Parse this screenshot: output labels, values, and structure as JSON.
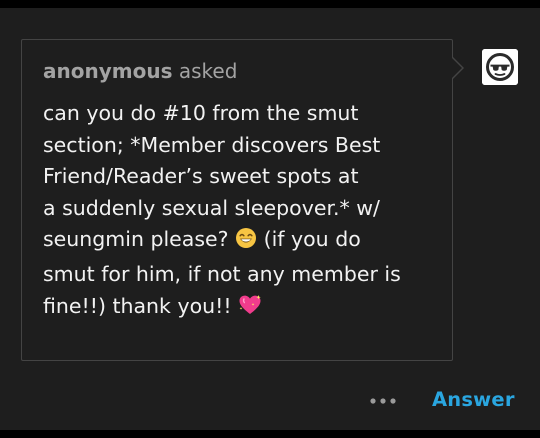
{
  "ask": {
    "asker": "anonymous",
    "asked_label": "asked",
    "question_lines": [
      "can you do #10 from the smut",
      "section; *Member discovers Best",
      "Friend/Reader’s sweet spots at",
      "a suddenly sexual sleepover.* w/",
      "seungmin please? ",
      "(if you do",
      "smut for him, if not any member is",
      "fine!!) thank you!! "
    ],
    "emoji_grin": "grinning-face-with-smiling-eyes",
    "emoji_heart": "sparkling-heart"
  },
  "footer": {
    "more_icon": "ellipsis-icon",
    "answer_label": "Answer"
  },
  "colors": {
    "background": "#1e1e1e",
    "bubble_border": "#444444",
    "text": "#f2f2f2",
    "muted": "#a3a3a3",
    "accent": "#2aa6e0"
  },
  "avatar": {
    "icon": "sunglasses-logo-icon"
  }
}
